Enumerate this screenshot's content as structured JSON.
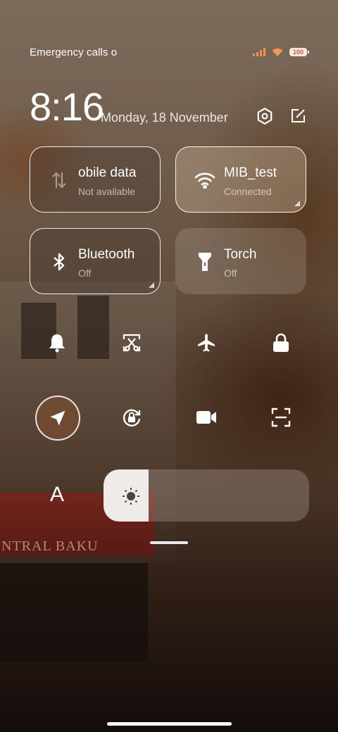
{
  "status_bar": {
    "carrier_text": "Emergency calls o",
    "battery_level": "100"
  },
  "header": {
    "time": "8:16",
    "date": "Monday, 18 November"
  },
  "tiles": [
    {
      "title": "obile data",
      "subtitle": "Not available",
      "icon": "mobile-data-icon",
      "state": "off"
    },
    {
      "title": "MIB_test",
      "subtitle": "Connected",
      "icon": "wifi-icon",
      "state": "on"
    },
    {
      "title": "Bluetooth",
      "subtitle": "Off",
      "icon": "bluetooth-icon",
      "state": "off"
    },
    {
      "title": "Torch",
      "subtitle": "Off",
      "icon": "torch-icon",
      "state": "off"
    }
  ],
  "toggles": [
    {
      "icon": "bell-icon",
      "state": "off"
    },
    {
      "icon": "screenshot-icon",
      "state": "off"
    },
    {
      "icon": "airplane-icon",
      "state": "off"
    },
    {
      "icon": "lock-icon",
      "state": "off"
    },
    {
      "icon": "location-icon",
      "state": "on"
    },
    {
      "icon": "rotation-lock-icon",
      "state": "off"
    },
    {
      "icon": "video-icon",
      "state": "off"
    },
    {
      "icon": "scan-icon",
      "state": "off"
    }
  ],
  "brightness": {
    "auto_label": "A",
    "level_fraction": 0.22
  },
  "background_text": "NTRAL BAKU",
  "colors": {
    "accent": "#f39a5a",
    "battery_text": "#d9573b",
    "slider_fill": "#efebe8"
  }
}
